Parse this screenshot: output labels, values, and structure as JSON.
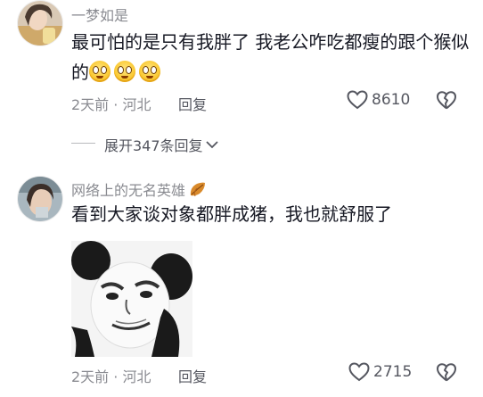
{
  "comments": [
    {
      "username": "一梦如是",
      "text": "最可怕的是只有我胖了 我老公咋吃都瘦的跟个猴似的",
      "meta": "2天前 · 河北",
      "reply_label": "回复",
      "like_count": "8610",
      "emojis": [
        "grinning-face",
        "grinning-face",
        "grinning-face"
      ]
    },
    {
      "username": "网络上的无名英雄",
      "badge": "leaf-icon",
      "text": "看到大家谈对象都胖成猪，我也就舒服了",
      "meta": "2天前 · 河北",
      "reply_label": "回复",
      "like_count": "2715",
      "sticker": "panda-meme-sticker"
    }
  ],
  "expand_replies": "展开347条回复",
  "colors": {
    "primary_text": "#161823",
    "secondary_text": "#8a8b91",
    "action_text": "#555760"
  }
}
